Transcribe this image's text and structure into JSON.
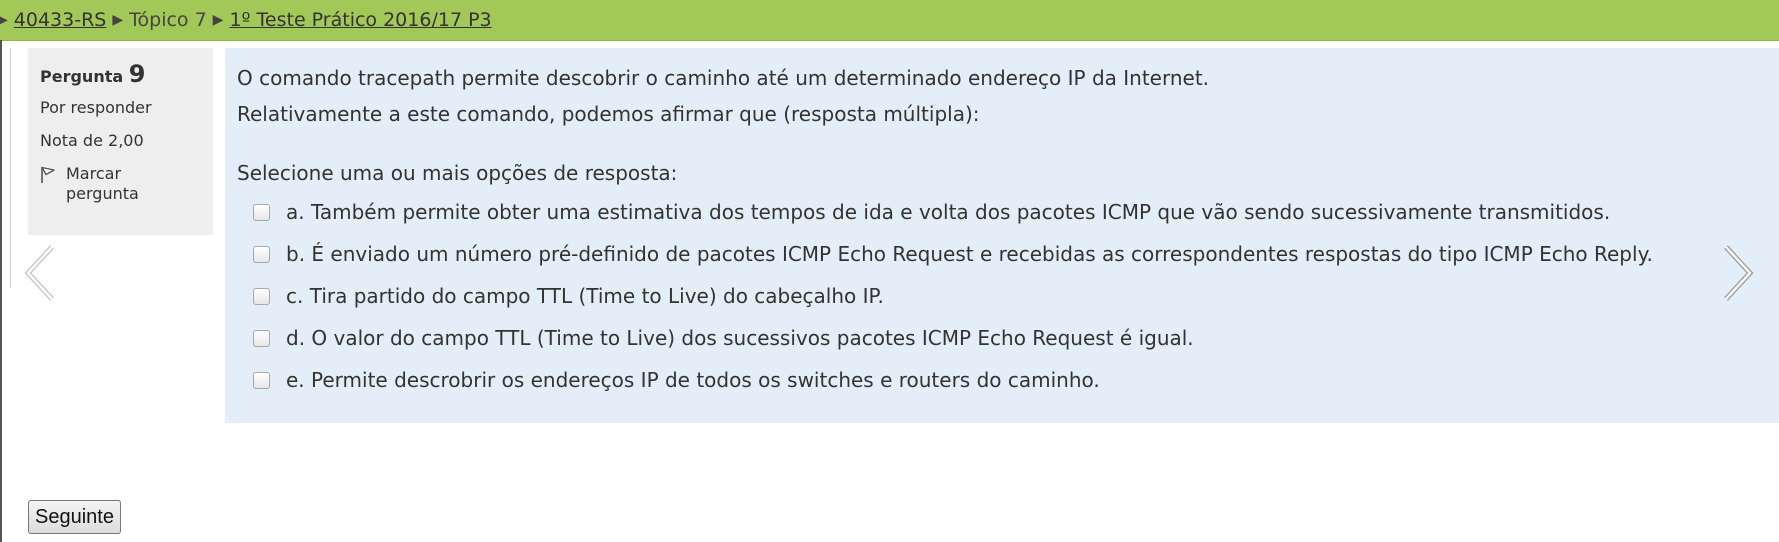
{
  "breadcrumb": {
    "items": [
      {
        "label": "40433-RS",
        "link": true
      },
      {
        "label": "Tópico 7",
        "link": false
      },
      {
        "label": "1º Teste Prático 2016/17 P3",
        "link": true
      }
    ]
  },
  "question_info": {
    "title_label": "Pergunta",
    "number": "9",
    "state": "Por responder",
    "grade": "Nota de 2,00",
    "flag_line1": "Marcar",
    "flag_line2": "pergunta"
  },
  "question": {
    "text_1": "O comando tracepath permite descobrir o caminho até um determinado endereço IP da Internet.",
    "text_2": "Relativamente a este comando, podemos afirmar que (resposta múltipla):",
    "prompt": "Selecione uma ou mais opções de resposta:",
    "options": [
      {
        "label": "a. Também permite obter uma estimativa dos tempos de ida e volta dos pacotes ICMP que vão sendo sucessivamente transmitidos.",
        "checked": false
      },
      {
        "label": "b. É enviado um número pré-definido de pacotes ICMP Echo Request e recebidas as correspondentes respostas do tipo ICMP Echo Reply.",
        "checked": false
      },
      {
        "label": "c. Tira partido do campo TTL (Time to Live) do cabeçalho IP.",
        "checked": false
      },
      {
        "label": "d. O valor do campo TTL (Time to Live) dos sucessivos pacotes ICMP Echo Request é igual.",
        "checked": false
      },
      {
        "label": "e. Permite descrobrir os endereços IP de todos os switches e routers do caminho.",
        "checked": false
      }
    ]
  },
  "navigation": {
    "next_button_label": "Seguinte",
    "prev_icon": "chevron-left-icon",
    "next_icon": "chevron-right-icon"
  },
  "colors": {
    "breadcrumb_bg": "#a2c857",
    "info_bg": "#eeeeee",
    "content_bg": "#e3eef8"
  }
}
